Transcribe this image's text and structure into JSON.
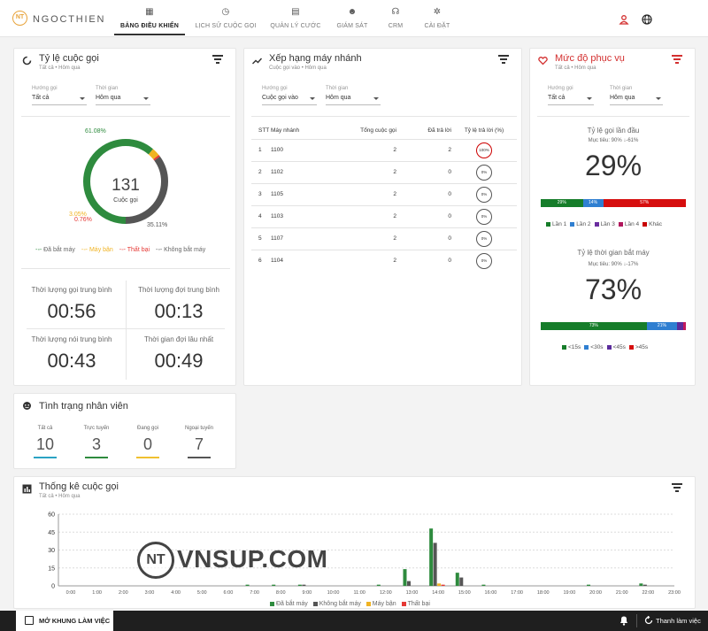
{
  "header": {
    "logo_mark": "NT",
    "logo_text": "NGOCTHIEN",
    "nav": [
      {
        "label": "BẢNG ĐIỀU KHIỂN",
        "icon": "dashboard-icon",
        "glyph": "▦",
        "active": true
      },
      {
        "label": "LỊCH SỬ CUỘC GỌI",
        "icon": "history-icon",
        "glyph": "◷",
        "active": false
      },
      {
        "label": "QUẢN LÝ CƯỚC",
        "icon": "billing-icon",
        "glyph": "▤",
        "active": false
      },
      {
        "label": "GIÁM SÁT",
        "icon": "monitor-icon",
        "glyph": "☻",
        "active": false
      },
      {
        "label": "CRM",
        "icon": "headset-icon",
        "glyph": "☊",
        "active": false
      },
      {
        "label": "CÀI ĐẶT",
        "icon": "gear-icon",
        "glyph": "✲",
        "active": false
      }
    ]
  },
  "call_rate": {
    "title": "Tỷ lệ cuộc gọi",
    "subtitle": "Tất cả • Hôm qua",
    "filter1_label": "Hướng gọi",
    "filter1_value": "Tất cả",
    "filter2_label": "Thời gian",
    "filter2_value": "Hôm qua",
    "total": "131",
    "total_label": "Cuộc gọi",
    "pct_answered": "61.08%",
    "pct_missed": "35.11%",
    "pct_busy": "3.05%",
    "pct_failed": "0.76%",
    "legend": [
      "Đã bắt máy",
      "Máy bận",
      "Thất bại",
      "Không bắt máy"
    ],
    "colors": [
      "#2e8b3e",
      "#f0b323",
      "#e53935",
      "#555555"
    ],
    "stats": [
      {
        "label": "Thời lượng gọi trung bình",
        "value": "00:56"
      },
      {
        "label": "Thời lượng đợi trung bình",
        "value": "00:13"
      },
      {
        "label": "Thời lượng nói trung bình",
        "value": "00:43"
      },
      {
        "label": "Thời gian đợi lâu nhất",
        "value": "00:49"
      }
    ]
  },
  "ranking": {
    "title": "Xếp hạng máy nhánh",
    "subtitle": "Cuộc gọi vào • Hôm qua",
    "filter1_label": "Hướng gọi",
    "filter1_value": "Cuộc gọi vào",
    "filter2_label": "Thời gian",
    "filter2_value": "Hôm qua",
    "cols": [
      "STT",
      "Máy nhánh",
      "Tổng cuộc gọi",
      "Đã trả lời",
      "Tỷ lệ trả lời (%)"
    ],
    "rows": [
      [
        "1",
        "1100",
        "2",
        "2",
        "100%"
      ],
      [
        "2",
        "1102",
        "2",
        "0",
        "0%"
      ],
      [
        "3",
        "1105",
        "2",
        "0",
        "0%"
      ],
      [
        "4",
        "1103",
        "2",
        "0",
        "0%"
      ],
      [
        "5",
        "1107",
        "2",
        "0",
        "0%"
      ],
      [
        "6",
        "1104",
        "2",
        "0",
        "0%"
      ]
    ]
  },
  "service": {
    "title": "Mức độ phục vụ",
    "subtitle": "Tất cả • Hôm qua",
    "filter1_label": "Hướng gọi",
    "filter1_value": "Tất cả",
    "filter2_label": "Thời gian",
    "filter2_value": "Hôm qua",
    "first_title": "Tỷ lệ gọi lần đầu",
    "first_target": "Mục tiêu: 90%  ↓-61%",
    "first_value": "29%",
    "first_bar": [
      {
        "label": "29%",
        "value": 29,
        "color": "#167d2a"
      },
      {
        "label": "14%",
        "value": 14,
        "color": "#2f7fd1"
      },
      {
        "label": "57%",
        "value": 57,
        "color": "#d60e0e"
      }
    ],
    "first_legend": [
      {
        "label": "Lần 1",
        "color": "#167d2a"
      },
      {
        "label": "Lần 2",
        "color": "#2f7fd1"
      },
      {
        "label": "Lần 3",
        "color": "#6a2d9f"
      },
      {
        "label": "Lần 4",
        "color": "#b0175c"
      },
      {
        "label": "Khác",
        "color": "#c80000"
      }
    ],
    "pickup_title": "Tỷ lệ thời gian bắt máy",
    "pickup_target": "Mục tiêu: 90%  ↓-17%",
    "pickup_value": "73%",
    "pickup_bar": [
      {
        "label": "73%",
        "value": 73,
        "color": "#167d2a"
      },
      {
        "label": "21%",
        "value": 21,
        "color": "#2f7fd1"
      },
      {
        "label": "",
        "value": 4,
        "color": "#5b2b9c"
      },
      {
        "label": "",
        "value": 2,
        "color": "#c2185b"
      }
    ],
    "pickup_legend": [
      {
        "label": "<15s",
        "color": "#167d2a"
      },
      {
        "label": "<30s",
        "color": "#2f7fd1"
      },
      {
        "label": "<45s",
        "color": "#5b2b9c"
      },
      {
        "label": ">45s",
        "color": "#d60e0e"
      }
    ]
  },
  "staff": {
    "title": "Tình trạng nhân viên",
    "items": [
      {
        "label": "Tất cả",
        "value": "10",
        "color": "#2ba3c4"
      },
      {
        "label": "Trực tuyến",
        "value": "3",
        "color": "#2e8b3e"
      },
      {
        "label": "Đang gọi",
        "value": "0",
        "color": "#f0c030"
      },
      {
        "label": "Ngoại tuyến",
        "value": "7",
        "color": "#555555"
      }
    ]
  },
  "stats_chart": {
    "title": "Thống kê cuộc gọi",
    "subtitle": "Tất cả • Hôm qua",
    "legend": [
      "Đã bắt máy",
      "Không bắt máy",
      "Máy bận",
      "Thất bại"
    ]
  },
  "chart_data": {
    "type": "bar",
    "categories": [
      "0:00",
      "1:00",
      "2:00",
      "3:00",
      "4:00",
      "5:00",
      "6:00",
      "7:00",
      "8:00",
      "9:00",
      "10:00",
      "11:00",
      "12:00",
      "13:00",
      "14:00",
      "15:00",
      "16:00",
      "17:00",
      "18:00",
      "19:00",
      "20:00",
      "21:00",
      "22:00",
      "23:00"
    ],
    "series": [
      {
        "name": "Đã bắt máy",
        "color": "#2e8b3e",
        "values": [
          0,
          0,
          0,
          0,
          0,
          0,
          0,
          1,
          1,
          1,
          0,
          0,
          1,
          14,
          48,
          11,
          1,
          0,
          0,
          0,
          1,
          0,
          2,
          0
        ]
      },
      {
        "name": "Không bắt máy",
        "color": "#555555",
        "values": [
          0,
          0,
          0,
          0,
          0,
          0,
          0,
          0,
          0,
          1,
          0,
          0,
          0,
          4,
          36,
          7,
          0,
          0,
          0,
          0,
          0,
          0,
          1,
          0
        ]
      },
      {
        "name": "Máy bận",
        "color": "#f0b323",
        "values": [
          0,
          0,
          0,
          0,
          0,
          0,
          0,
          0,
          0,
          0,
          0,
          0,
          0,
          0,
          2,
          0,
          0,
          0,
          0,
          0,
          0,
          0,
          0,
          0
        ]
      },
      {
        "name": "Thất bại",
        "color": "#e53935",
        "values": [
          0,
          0,
          0,
          0,
          0,
          0,
          0,
          0,
          0,
          0,
          0,
          0,
          0,
          0,
          1,
          0,
          0,
          0,
          0,
          0,
          0,
          0,
          0,
          0
        ]
      }
    ],
    "yticks": [
      0,
      15,
      30,
      45,
      60
    ],
    "ylim": [
      0,
      60
    ]
  },
  "watermark": {
    "mark": "NT",
    "text": "VNSUP.COM"
  },
  "footer": {
    "left": "MỞ KHUNG LÀM VIỆC",
    "right": "Thanh làm việc"
  }
}
